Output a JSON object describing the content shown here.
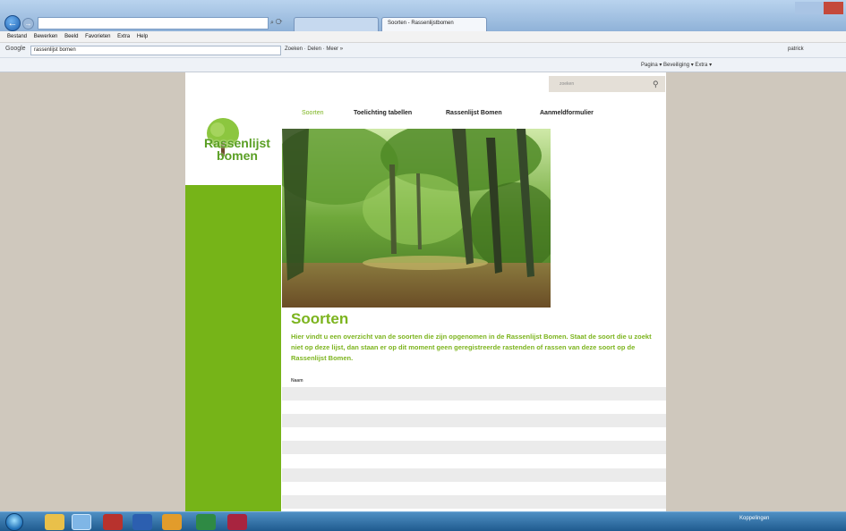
{
  "browser": {
    "quick_access": "",
    "address": "",
    "tabs": [
      {
        "label": ""
      },
      {
        "label": "Soorten - Rassenlijstbomen"
      }
    ],
    "menu": [
      "Bestand",
      "Bewerken",
      "Beeld",
      "Favorieten",
      "Extra",
      "Help"
    ],
    "google": {
      "logo": "Google",
      "query": "rassenlijst bomen",
      "tools": "Zoeken · Delen · Meer »",
      "right": "patrick"
    },
    "favorites": [
      "",
      "",
      "",
      "",
      "",
      "",
      "",
      "",
      "",
      "",
      "",
      "",
      "",
      "",
      ""
    ],
    "favorites_right": "Pagina ▾  Beveiliging ▾  Extra ▾"
  },
  "site": {
    "utility_nav": [
      "",
      "",
      "",
      ""
    ],
    "search_placeholder": "zoeken",
    "search_icon": "magnifier-icon",
    "logo_text_line1": "Rassenlijst",
    "logo_text_line2": "bomen",
    "nav": {
      "soorten": "Soorten",
      "toelichting": "Toelichting tabellen",
      "rassenlijst": "Rassenlijst Bomen",
      "aanmeld": "Aanmeldformulier"
    },
    "title": "Soorten",
    "intro": "Hier vindt u een overzicht van de soorten die zijn opgenomen in de Rassenlijst Bomen. Staat de soort die u zoekt niet op deze lijst, dan staan er op dit moment geen geregistreerde rastenden of rassen van deze soort op de Rassenlijst Bomen.",
    "list_header": "Naam",
    "species": [
      "",
      "",
      "",
      "",
      "",
      "",
      "",
      "",
      "",
      "",
      ""
    ]
  },
  "taskbar": {
    "tray": "Koppelingen",
    "time": "",
    "date": ""
  },
  "colors": {
    "accent_green": "#7cb41e",
    "sidebar_green": "#76b418",
    "page_bg": "#cfc8bd"
  }
}
